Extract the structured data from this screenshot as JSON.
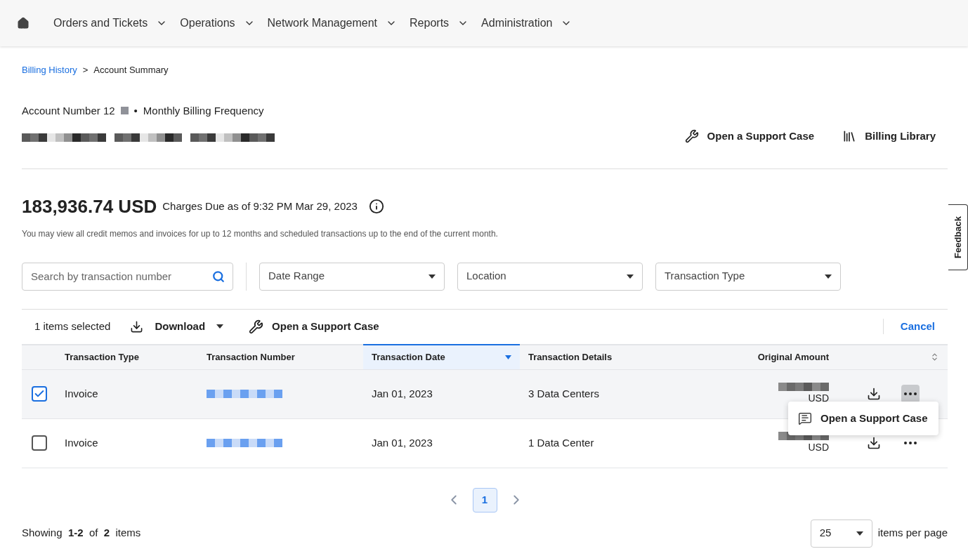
{
  "nav": {
    "items": [
      {
        "label": "Orders and Tickets"
      },
      {
        "label": "Operations"
      },
      {
        "label": "Network Management"
      },
      {
        "label": "Reports"
      },
      {
        "label": "Administration"
      }
    ]
  },
  "breadcrumb": {
    "link": "Billing History",
    "separator": ">",
    "current": "Account Summary"
  },
  "account": {
    "number": "Account Number 12",
    "separator": "•",
    "frequency": "Monthly Billing Frequency"
  },
  "actions": [
    {
      "label": "Open a Support Case",
      "kind": "tools"
    },
    {
      "label": "Billing Library",
      "kind": "library"
    }
  ],
  "summary": {
    "amount": "183,936.74 USD",
    "label": "Charges Due as of 9:32 PM Mar 29, 2023",
    "note": "You may view all credit memos and invoices for up to 12 months and scheduled transactions up to the end of the current month."
  },
  "filters": {
    "search_placeholder": "Search by transaction number",
    "dropdowns": [
      "Date Range",
      "Location",
      "Transaction Type"
    ]
  },
  "selection_bar": {
    "count": "1 items selected",
    "download": "Download",
    "support": "Open a Support Case",
    "cancel": "Cancel"
  },
  "table": {
    "columns": [
      {
        "label": "Transaction Type",
        "sorted": false
      },
      {
        "label": "Transaction Number",
        "sorted": false
      },
      {
        "label": "Transaction Date",
        "sorted": true
      },
      {
        "label": "Transaction Details",
        "sorted": false
      },
      {
        "label": "Original Amount",
        "sorted": false
      }
    ],
    "rows": [
      {
        "selected": true,
        "type": "Invoice",
        "date": "Jan 01, 2023",
        "details": "3 Data Centers",
        "currency": "USD",
        "menu_hover": true
      },
      {
        "selected": false,
        "type": "Invoice",
        "date": "Jan 01, 2023",
        "details": "1 Data Center",
        "currency": "USD",
        "menu_hover": false
      }
    ]
  },
  "tooltip": {
    "label": "Open a Support Case"
  },
  "pagination": {
    "pages": [
      {
        "label": "1",
        "selected": true
      }
    ]
  },
  "footer": {
    "showing": "Showing  **1-2**  of  **2**  items",
    "per_page": "25",
    "per_page_label": "items per page"
  },
  "feedback": {
    "label": "Feedback"
  }
}
